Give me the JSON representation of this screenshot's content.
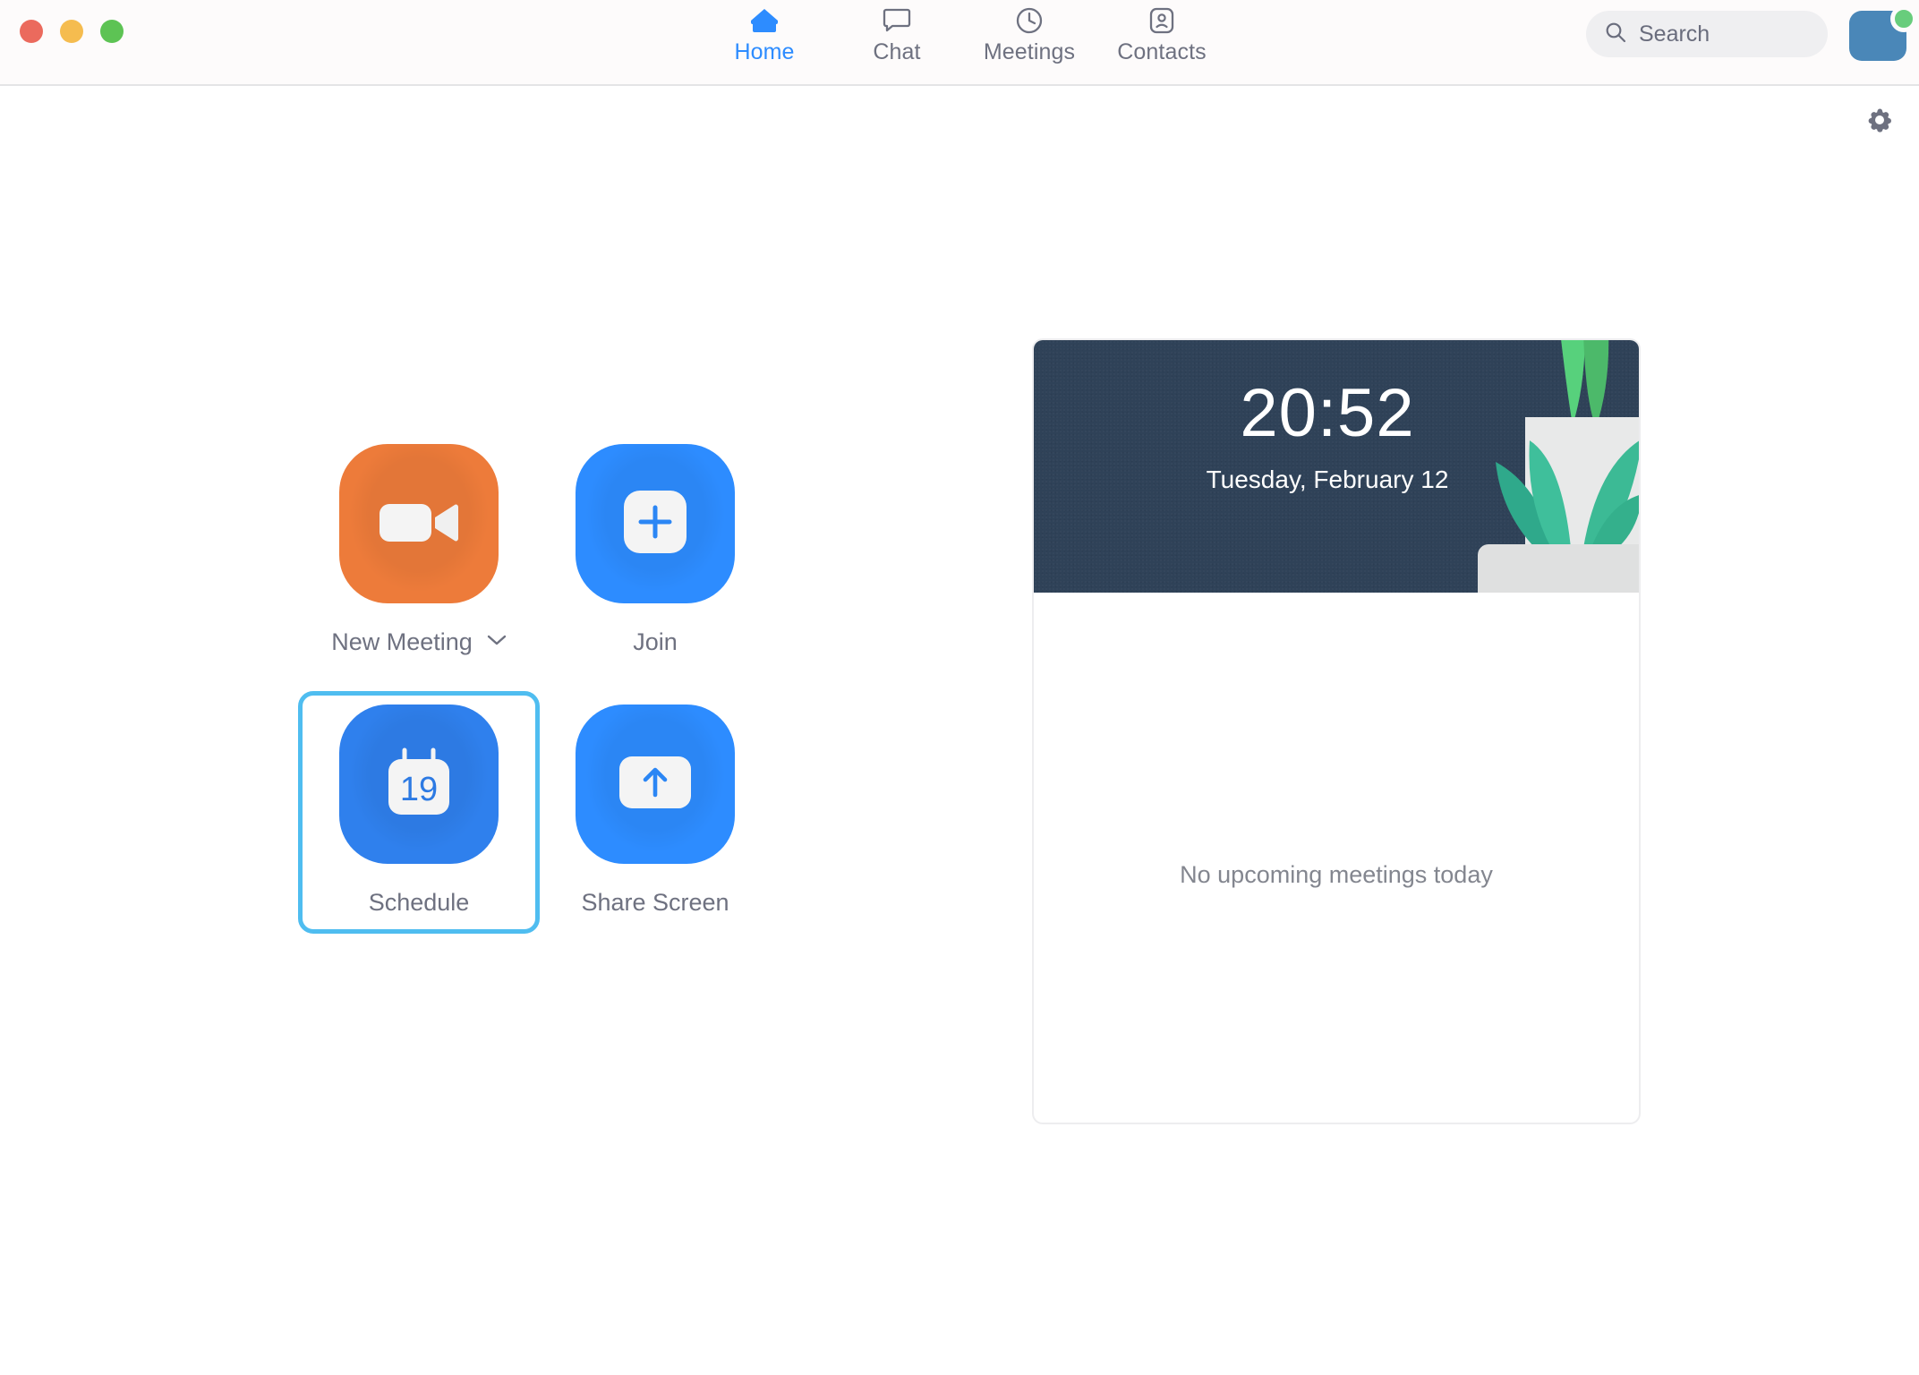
{
  "window": {
    "traffic_lights": [
      {
        "name": "close",
        "color": "#eb6a5d"
      },
      {
        "name": "minimize",
        "color": "#f5bc4f"
      },
      {
        "name": "maximize",
        "color": "#5dc354"
      }
    ]
  },
  "nav": {
    "tabs": [
      {
        "label": "Home",
        "icon": "home-icon",
        "active": true
      },
      {
        "label": "Chat",
        "icon": "chat-bubble-icon",
        "active": false
      },
      {
        "label": "Meetings",
        "icon": "clock-icon",
        "active": false
      },
      {
        "label": "Contacts",
        "icon": "contact-card-icon",
        "active": false
      }
    ],
    "active_color": "#2d8cff",
    "inactive_color": "#6e7180"
  },
  "search": {
    "placeholder": "Search",
    "value": "",
    "icon": "search-icon"
  },
  "account": {
    "avatar_color": "#4a87b8",
    "status": "available",
    "status_color": "#68cd7c"
  },
  "settings": {
    "icon": "gear-icon",
    "label": "Settings"
  },
  "actions": [
    {
      "label": "New Meeting",
      "icon": "video-camera-icon",
      "tile_color": "#ed7b3a",
      "has_dropdown": true,
      "focused": false
    },
    {
      "label": "Join",
      "icon": "plus-icon",
      "tile_color": "#2d8cff",
      "has_dropdown": false,
      "focused": false
    },
    {
      "label": "Schedule",
      "icon": "calendar-icon",
      "tile_color": "#2f80ed",
      "calendar_day": "19",
      "has_dropdown": false,
      "focused": true
    },
    {
      "label": "Share Screen",
      "icon": "share-screen-up-arrow-icon",
      "tile_color": "#2d8cff",
      "has_dropdown": false,
      "focused": false
    }
  ],
  "focus_ring_color": "#4fbdf0",
  "meeting_card": {
    "time": "20:52",
    "date": "Tuesday, February 12",
    "banner_color": "#2f4258",
    "empty_message": "No upcoming meetings today"
  }
}
